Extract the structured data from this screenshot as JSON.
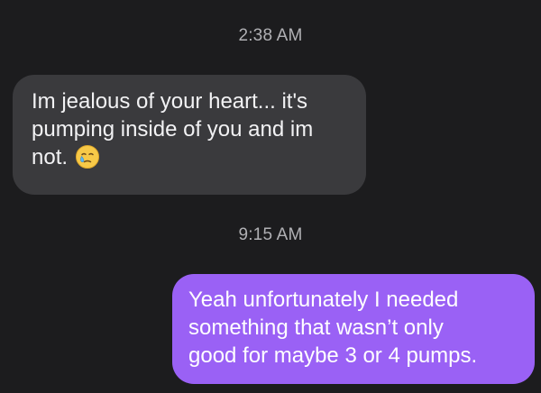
{
  "conversation": {
    "messages": [
      {
        "timestamp": "2:38 AM",
        "direction": "incoming",
        "lines": [
          "Im jealous of your heart... it's",
          "pumping inside of you and im",
          "not."
        ],
        "emoji": "face-holding-back-tears-icon"
      },
      {
        "timestamp": "9:15 AM",
        "direction": "outgoing",
        "lines": [
          "Yeah unfortunately I needed",
          "something that wasn’t only",
          "good for maybe 3 or 4 pumps."
        ]
      }
    ]
  },
  "colors": {
    "background": "#1c1c1e",
    "incoming_bubble": "#3a3a3d",
    "outgoing_bubble": "#9a61f5",
    "timestamp_text": "#b0b0b4"
  }
}
